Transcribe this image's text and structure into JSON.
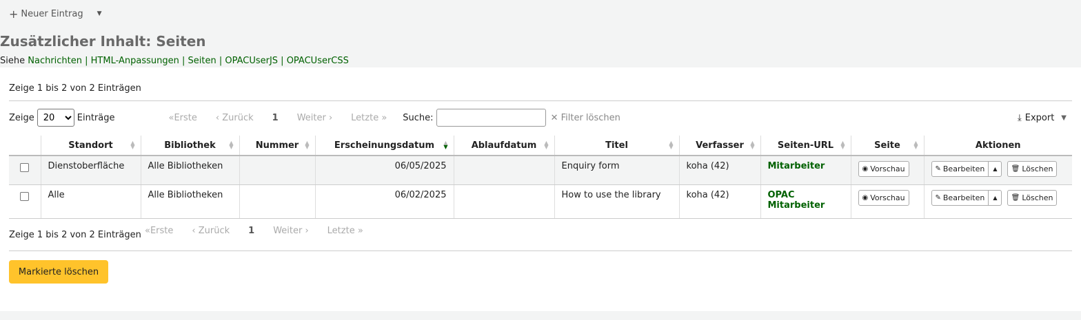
{
  "toolbar": {
    "new_entry_label": "Neuer Eintrag"
  },
  "page": {
    "title": "Zusätzlicher Inhalt: Seiten",
    "see_also_prefix": "Siehe",
    "see_also_links": "Nachrichten | HTML-Anpassungen | Seiten | OPACUserJS | OPACUserCSS"
  },
  "table_info": "Zeige 1 bis 2 von 2 Einträgen",
  "controls": {
    "show_label": "Zeige",
    "page_size": "20",
    "entries_label": "Einträge",
    "first": "«Erste",
    "prev": "‹ Zurück",
    "page": "1",
    "next": "Weiter ›",
    "last": "Letzte »",
    "search_label": "Suche:",
    "clear_filter": "Filter löschen",
    "export": "Export"
  },
  "columns": [
    "Standort",
    "Bibliothek",
    "Nummer",
    "Erscheinungsdatum",
    "Ablaufdatum",
    "Titel",
    "Verfasser",
    "Seiten-URL",
    "Seite",
    "Aktionen"
  ],
  "rows": [
    {
      "location": "Dienstoberfläche",
      "library": "Alle Bibliotheken",
      "number": "",
      "published": "06/05/2025",
      "expires": "",
      "title": "Enquiry form",
      "author": "koha (42)",
      "url1": "Mitarbeiter",
      "url2": ""
    },
    {
      "location": "Alle",
      "library": "Alle Bibliotheken",
      "number": "",
      "published": "06/02/2025",
      "expires": "",
      "title": "How to use the library",
      "author": "koha (42)",
      "url1": "OPAC",
      "url2": "Mitarbeiter"
    }
  ],
  "actions": {
    "preview": "Vorschau",
    "edit": "Bearbeiten",
    "delete": "Löschen"
  },
  "footer": {
    "delete_marked": "Markierte löschen"
  },
  "colors": {
    "link": "#006100",
    "primary_button": "#ffc32b"
  }
}
